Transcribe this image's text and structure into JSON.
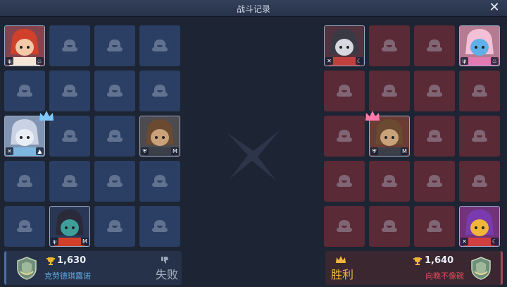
{
  "window": {
    "title": "战斗记录"
  },
  "left_team": {
    "score": "1,630",
    "player_name": "克劳德琪露诺",
    "result": "失败",
    "accent": "#5fa7e0",
    "heroes": [
      {
        "icon": "fire-girl-hero-icon",
        "badges": [
          "ψ",
          "♨"
        ]
      },
      {
        "icon": "white-fox-girl-hero-icon",
        "badges": [
          "✕",
          "▲"
        ]
      },
      {
        "icon": "brown-hair-knight-hero-icon",
        "badges": [
          "⛨",
          "M"
        ]
      },
      {
        "icon": "witch-hat-girl-hero-icon",
        "badges": [
          "ψ",
          "M"
        ]
      }
    ]
  },
  "right_team": {
    "score": "1,640",
    "player_name": "向晚不像碗",
    "result": "胜利",
    "accent": "#e7a830",
    "heroes": [
      {
        "icon": "wolf-girl-hero-icon",
        "badges": [
          "✕",
          "☾"
        ]
      },
      {
        "icon": "blue-hair-girl-hero-icon",
        "badges": [
          "ψ",
          "♨"
        ]
      },
      {
        "icon": "brown-hair-knight-hero-icon",
        "badges": [
          "⛨",
          "M"
        ]
      },
      {
        "icon": "fire-demon-hero-icon",
        "badges": [
          "✕",
          "☾"
        ]
      }
    ]
  },
  "colors": {
    "left_empty": "#2a3f63",
    "right_empty": "#5a2a36",
    "win": "#e7a830",
    "lose_name": "#5fa7e0",
    "win_name": "#e24a5a"
  }
}
